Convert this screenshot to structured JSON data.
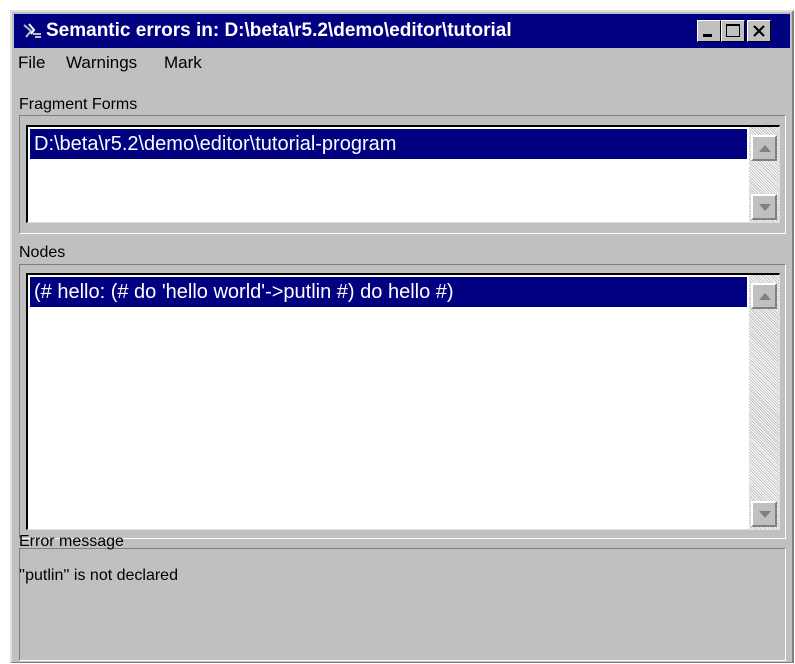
{
  "window": {
    "title": "Semantic errors in: D:\\beta\\r5.2\\demo\\editor\\tutorial",
    "controls": {
      "minimize": "minimize",
      "maximize": "maximize",
      "close": "close"
    }
  },
  "menu": {
    "file": "File",
    "warnings": "Warnings",
    "mark": "Mark"
  },
  "fragment_forms": {
    "label": "Fragment Forms",
    "selected": "D:\\beta\\r5.2\\demo\\editor\\tutorial-program"
  },
  "nodes": {
    "label": "Nodes",
    "selected": "(# hello: (#  do 'hello world'->putlin #) do hello #)"
  },
  "error_message": {
    "label": "Error message",
    "text": "''putlin'' is not declared"
  },
  "colors": {
    "titlebar": "#000080",
    "face": "#c0c0c0",
    "selection": "#000080"
  }
}
